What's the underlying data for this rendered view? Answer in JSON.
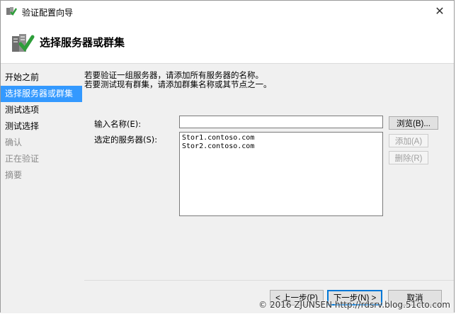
{
  "window": {
    "title": "验证配置向导",
    "close_glyph": "✕"
  },
  "header": {
    "title": "选择服务器或群集"
  },
  "sidebar": {
    "items": [
      {
        "label": "开始之前",
        "state": "normal"
      },
      {
        "label": "选择服务器或群集",
        "state": "active"
      },
      {
        "label": "测试选项",
        "state": "normal"
      },
      {
        "label": "测试选择",
        "state": "normal"
      },
      {
        "label": "确认",
        "state": "disabled"
      },
      {
        "label": "正在验证",
        "state": "disabled"
      },
      {
        "label": "摘要",
        "state": "disabled"
      }
    ]
  },
  "main": {
    "description_line1": "若要验证一组服务器，请添加所有服务器的名称。",
    "description_line2": "若要测试现有群集，请添加群集名称或其节点之一。",
    "name_label": "输入名称(E):",
    "name_value": "",
    "selected_label": "选定的服务器(S):",
    "servers": [
      "Stor1.contoso.com",
      "Stor2.contoso.com"
    ],
    "browse_button": "浏览(B)...",
    "add_button": "添加(A)",
    "remove_button": "删除(R)"
  },
  "footer": {
    "prev_button": "< 上一步(P)",
    "next_button": "下一步(N) >",
    "cancel_button": "取消"
  },
  "watermark": "© 2016 ZJUNSEN http://rdsrv.blog.51cto.com",
  "colors": {
    "active_step": "#3399ff",
    "content_bg": "#f0f0f0",
    "primary_border": "#0078d7"
  }
}
